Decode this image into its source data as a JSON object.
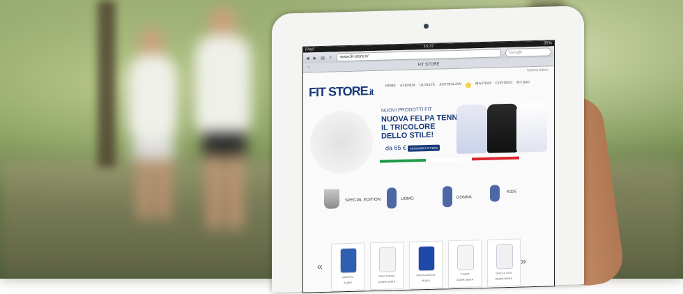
{
  "status_bar": {
    "device": "iPad",
    "time": "15:37",
    "battery": "35% "
  },
  "browser": {
    "url": "www.fit-store.it/",
    "search_placeholder": "Google",
    "tab_title": "FIT STORE",
    "close_tab": "×"
  },
  "site": {
    "language_link": "Italiano Italian",
    "logo_main": "FIT STORE",
    "logo_suffix": ".it",
    "nav": [
      "HOME",
      "AZIENDA",
      "QUALITÀ",
      "AUSTRALIAN",
      "MASTERS",
      "CONTATTI",
      "FIT BAG"
    ],
    "hero": {
      "kicker": "NUOVI PRODOTTI FIT",
      "line1": "NUOVA FELPA TENNIS,",
      "line2": "IL TRICOLORE",
      "line3": "DELLO STILE!",
      "price": "da 65 €",
      "button": "AGGIUNGI A FIT BAG"
    },
    "categories": [
      "SPECIAL EDITION",
      "UOMO",
      "DONNA",
      "KIDS"
    ],
    "products": [
      {
        "label": "CANOTTA",
        "price": "22,00 €",
        "color": "#2f5fb0"
      },
      {
        "label": "POLO DONNA",
        "price": "22,00 €  19,00 €",
        "color": "#f2f2f2"
      },
      {
        "label": "PANTALONCINO",
        "price": "25,00 €",
        "color": "#1e49a8"
      },
      {
        "label": "T-SHIRT",
        "price": "22,00 €  19,00 €",
        "color": "#f4f4f4"
      },
      {
        "label": "GIACCA TUTA",
        "price": "55,00 €  45,00 €",
        "color": "#f0f0f0"
      }
    ],
    "arrows": {
      "prev": "«",
      "next": "»"
    }
  },
  "colors": {
    "brand": "#1a3a7c",
    "italy_green": "#1f9a48",
    "italy_red": "#d9232e"
  }
}
